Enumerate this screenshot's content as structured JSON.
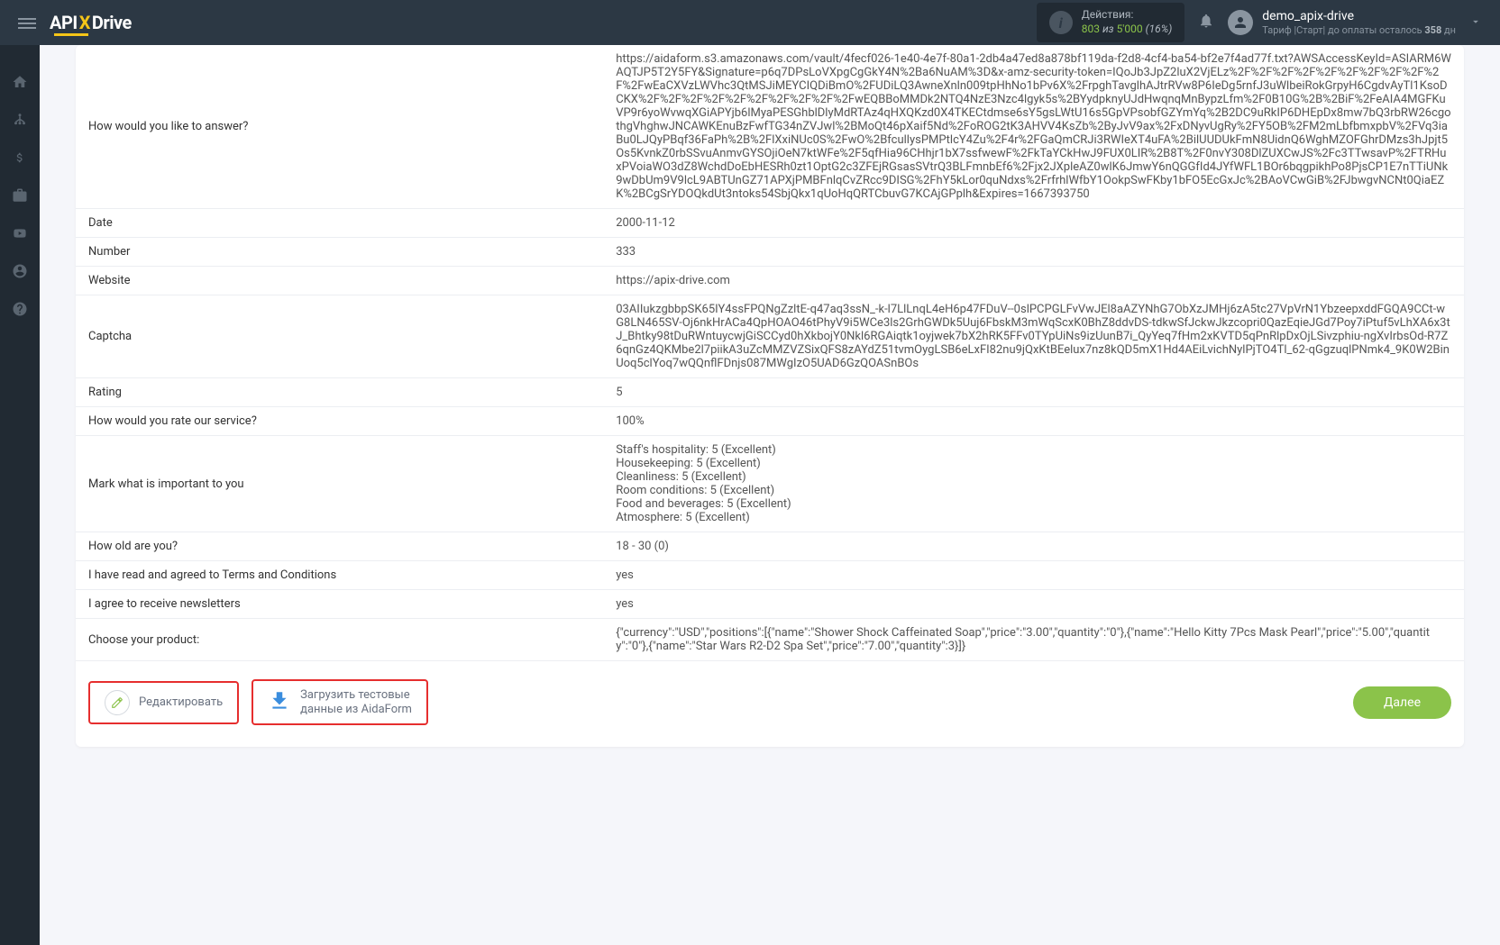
{
  "header": {
    "logo": {
      "part1": "API",
      "part2": "X",
      "part3": "Drive"
    },
    "actions": {
      "title": "Действия:",
      "used": "803",
      "sep": "из",
      "total": "5'000",
      "pct": "(16%)"
    },
    "user": {
      "name": "demo_apix-drive",
      "plan_prefix": "Тариф |Старт| до оплаты осталось ",
      "days": "358",
      "days_suffix": " дн"
    }
  },
  "rows": [
    {
      "label": "How would you like to answer?",
      "value": "https://aidaform.s3.amazonaws.com/vault/4fecf026-1e40-4e7f-80a1-2db4a47ed8a878bf119da-f2d8-4cf4-ba54-bf2e7f4ad77f.txt?AWSAccessKeyId=ASIARM6WAQTJP5T2Y5FY&Signature=p6q7DPsLoVXpgCgGkY4N%2Ba6NuAM%3D&x-amz-security-token=IQoJb3JpZ2luX2VjELz%2F%2F%2F%2F%2F%2F%2F%2F%2F%2F%2FwEaCXVzLWVhc3QtMSJiMEYCIQDiBmO%2FUDiLQ3AwneXnln009tpHhNo1bPv6X%2FrpghTavglhAJtrRVw8P6IeDg5rnfJ3uWlbeiRokGrpyH6CgdvAyTl1KsoDCKX%2F%2F%2F%2F%2F%2F%2F%2F%2F%2FwEQBBoMMDk2NTQ4NzE3Nzc4lgyk5s%2BYydpknyUJdHwqnqMnBypzLfm%2F0B10G%2B%2BiF%2FeAIA4MGFKuVP9r6yoWvwqXGiAPYjb6lMyaPESGhblDlyMdRTAz4qHXQKzd0X4TKECtdmse6sY5gsLWtU16s5GpVPsobfGZYmYq%2B2DC9uRkIP6DHEpDx8mw7bQ3rbRW26cgothgVhghwJNCAWKEnuBzFwfTG34nZVJwl%2BMoQt46pXaif5Nd%2FoROG2tK3AHVV4KsZb%2ByJvV9ax%2FxDNyvUgRy%2FY5OB%2FM2mLbfbmxpbV%2FVq3iaBu0LJQyPBqf36FaPh%2B%2FlXxiNUc0S%2FwO%2BfcullysPMPtlcY4Zu%2F4r%2FGaQmCRJi3RWIeXT4uFA%2BilUUDUkFmN8UidnQ6WghMZOFGhrDMzs3hJpjt5Os5KvnkZ0rbSSvuAnmvGYSOjiOeN7ktWFe%2F5qfHia96CHhjr1bX7ssfwewF%2FkTaYCkHwJ9FUX0LIR%2B8T%2F0nvY308DlZUXCwJS%2Fc3TTwsavP%2FTRHuxPVoiaWO3dZ8WchdDoEbHESRh0zt1OptG2c3ZFEjRGsasSVtrQ3BLFmnbEf6%2Fjx2JXpleAZ0wlK6JmwY6nQGGfId4JYfWFL1BOr6bqgpikhPo8PjsCP1E7nTTiUNk9wDbUm9V9lcL9ABTUnGZ71APXjPMBFnlqCvZRcc9DISG%2FhY5kLor0quNdxs%2FrfrhlWfbY1OokpSwFKby1bFO5EcGxJc%2BAoVCwGiB%2FJbwgvNCNt0QiaEZK%2BCgSrYDOQkdUt3ntoks54SbjQkx1qUoHqQRTCbuvG7KCAjGPplh&Expires=1667393750"
    },
    {
      "label": "Date",
      "value": "2000-11-12"
    },
    {
      "label": "Number",
      "value": "333"
    },
    {
      "label": "Website",
      "value": "https://apix-drive.com"
    },
    {
      "label": "Captcha",
      "value": "03AIIukzgbbpSK65IY4ssFPQNgZzltE-q47aq3ssN_-k-l7LlLnqL4eH6p47FDuV--0slPCPGLFvVwJEl8aAZYNhG7ObXzJMHj6zA5tc27VpVrN1YbzeepxddFGQA9CCt-wG8LN465SV-Oj6nkHrACa4QpHOAO46tPhyV9i5WCe3ls2GrhGWDk5Uuj6FbskM3mWqScxK0BhZ8ddvDS-tdkwSfJckwJkzcopri0QazEqieJGd7Poy7iPtuf5vLhXA6x3tJ_Bhtky98tDuRWntuycwjGiSCCyd0hXkbojY0Nkl6RGAiqtk1oyjwek7bX2hRK5FFv0TYpUiNs9izUunB7i_QyYeq7fHm2xKVTD5qPnRlpDxOjLSivzphiu-ngXvIrbsOd-R7Z6qnGz4QKMbe2l7piikA3uZcMMZVZSixQFS8zAYdZ51tvmOygLSB6eLxFI82nu9jQxKtBEelux7nz8kQD5mX1Hd4AEiLvichNylPjTO4Tl_62-qGgzuqlPNmk4_9K0W2BinUoq5clYoq7wQQnflFDnjs087MWgIzO5UAD6GzQOASnBOs"
    },
    {
      "label": "Rating",
      "value": "5"
    },
    {
      "label": "How would you rate our service?",
      "value": "100%"
    },
    {
      "label": "Mark what is important to you",
      "value": "Staff's hospitality: 5 (Excellent)\nHousekeeping: 5 (Excellent)\nCleanliness: 5 (Excellent)\nRoom conditions: 5 (Excellent)\nFood and beverages: 5 (Excellent)\nAtmosphere: 5 (Excellent)"
    },
    {
      "label": "How old are you?",
      "value": "18 - 30 (0)"
    },
    {
      "label": "I have read and agreed to Terms and Conditions",
      "value": "yes"
    },
    {
      "label": "I agree to receive newsletters",
      "value": "yes"
    },
    {
      "label": "Choose your product:",
      "value": "{\"currency\":\"USD\",\"positions\":[{\"name\":\"Shower Shock Caffeinated Soap\",\"price\":\"3.00\",\"quantity\":\"0\"},{\"name\":\"Hello Kitty 7Pcs Mask Pearl\",\"price\":\"5.00\",\"quantity\":\"0\"},{\"name\":\"Star Wars R2-D2 Spa Set\",\"price\":\"7.00\",\"quantity\":3}]}"
    }
  ],
  "buttons": {
    "edit": "Редактировать",
    "download_line1": "Загрузить тестовые",
    "download_line2": "данные из AidaForm",
    "next": "Далее"
  }
}
